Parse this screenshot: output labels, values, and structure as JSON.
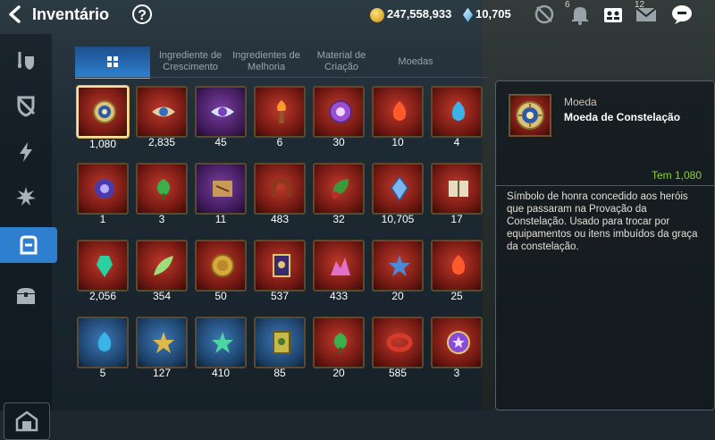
{
  "header": {
    "title": "Inventário",
    "help_label": "?",
    "gold": "247,558,933",
    "crystals": "10,705",
    "badge_alert": "6",
    "badge_mail": "12"
  },
  "tabs": [
    {
      "label": "",
      "icon": "grid-icon",
      "active": true
    },
    {
      "label": "Ingrediente de Crescimento"
    },
    {
      "label": "Ingredientes de Melhoria"
    },
    {
      "label": "Material de Criação"
    },
    {
      "label": "Moedas"
    }
  ],
  "items": [
    {
      "qty": "1,080",
      "icon": "constellation-coin-icon",
      "bg": "red"
    },
    {
      "qty": "2,835",
      "icon": "eye-emblem-icon",
      "bg": "red"
    },
    {
      "qty": "45",
      "icon": "eye-emblem-blue-icon",
      "bg": "purple"
    },
    {
      "qty": "6",
      "icon": "torch-icon",
      "bg": "red"
    },
    {
      "qty": "30",
      "icon": "purple-ring-coin-icon",
      "bg": "red"
    },
    {
      "qty": "10",
      "icon": "fire-charm-icon",
      "bg": "red"
    },
    {
      "qty": "4",
      "icon": "water-charm-icon",
      "bg": "red"
    },
    {
      "qty": "1",
      "icon": "blue-vortex-charm-icon",
      "bg": "red"
    },
    {
      "qty": "3",
      "icon": "green-leaf-charm-icon",
      "bg": "red"
    },
    {
      "qty": "11",
      "icon": "treasure-map-icon",
      "bg": "purple"
    },
    {
      "qty": "483",
      "icon": "horseshoe-icon",
      "bg": "red"
    },
    {
      "qty": "32",
      "icon": "leaf-potion-icon",
      "bg": "red"
    },
    {
      "qty": "10,705",
      "icon": "blue-crystal-icon",
      "bg": "red"
    },
    {
      "qty": "17",
      "icon": "book-icon",
      "bg": "red"
    },
    {
      "qty": "2,056",
      "icon": "green-gem-icon",
      "bg": "red"
    },
    {
      "qty": "354",
      "icon": "feather-icon",
      "bg": "red"
    },
    {
      "qty": "50",
      "icon": "gold-coin-icon",
      "bg": "red"
    },
    {
      "qty": "537",
      "icon": "purple-card-icon",
      "bg": "red"
    },
    {
      "qty": "433",
      "icon": "pink-crystals-icon",
      "bg": "red"
    },
    {
      "qty": "20",
      "icon": "blue-star-charm-icon",
      "bg": "red"
    },
    {
      "qty": "25",
      "icon": "fire-charm-icon",
      "bg": "red"
    },
    {
      "qty": "5",
      "icon": "water-charm-icon",
      "bg": "blue"
    },
    {
      "qty": "127",
      "icon": "gold-star-charm-icon",
      "bg": "blue"
    },
    {
      "qty": "410",
      "icon": "green-star-charm-icon",
      "bg": "blue"
    },
    {
      "qty": "85",
      "icon": "gold-card-icon",
      "bg": "blue"
    },
    {
      "qty": "20",
      "icon": "green-leaf-charm-icon",
      "bg": "red"
    },
    {
      "qty": "585",
      "icon": "red-bracelet-icon",
      "bg": "red"
    },
    {
      "qty": "3",
      "icon": "purple-medal-icon",
      "bg": "red"
    }
  ],
  "detail": {
    "category": "Moeda",
    "name": "Moeda de Constelação",
    "have": "Tem 1,080",
    "description": "Símbolo de honra concedido aos heróis que passaram na Provação da Constelação. Usado para trocar por equipamentos ou itens imbuídos da graça da constelação."
  },
  "colors": {
    "accent": "#2f7fd0",
    "have": "#8fce3c",
    "selected_border": "#f3e3a4"
  }
}
